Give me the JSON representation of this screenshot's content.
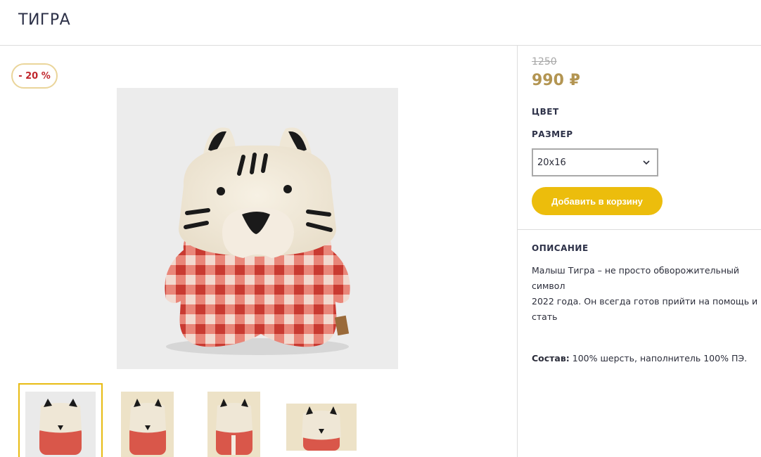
{
  "page": {
    "title": "ТИГРА"
  },
  "gallery": {
    "discount_badge": "- 20 %",
    "main_image_alt": "Мягкая игрушка Тигра",
    "thumbnails_count": 4
  },
  "product": {
    "old_price": "1250",
    "price": "990",
    "currency": "₽",
    "color_label": "ЦВЕТ",
    "size_label": "РАЗМЕР",
    "size_selected": "20x16",
    "add_to_cart": "Добавить в корзину",
    "description_heading": "ОПИСАНИЕ",
    "description": "Малыш Тигра – не просто обворожительный символ\n2022 года. Он всегда готов прийти на помощь и стать\nвам не только верным другом, но и удобной мини-\nподушечкой.",
    "composition_label": "Состав:",
    "composition_value": "100% шерсть, наполнитель 100% ПЭ."
  },
  "colors": {
    "accent": "#ecbd0c",
    "price": "#b39552",
    "discount": "#c0272d",
    "badge_border": "#ead59a",
    "plaid_red": "#d94a3f",
    "plaid_light": "#f2d9cf"
  },
  "icons": {
    "select_chevron": "chevron-down-icon"
  }
}
